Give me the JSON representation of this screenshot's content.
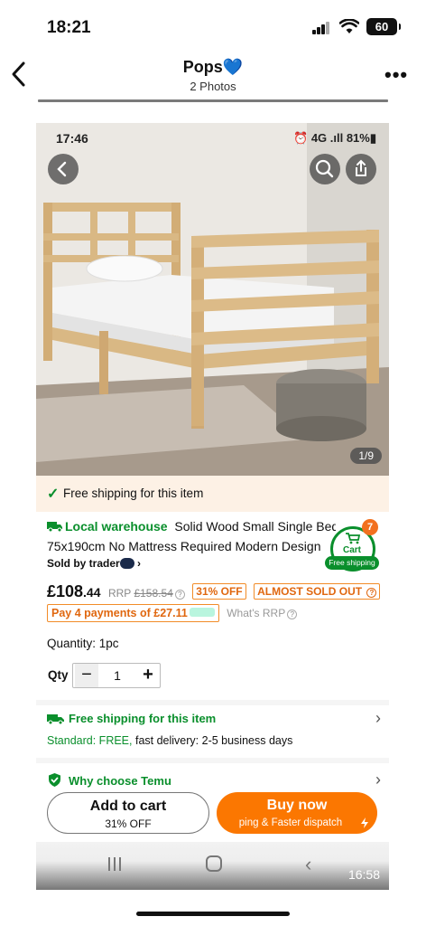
{
  "ios_status": {
    "time": "18:21",
    "battery": "60"
  },
  "header": {
    "title": "Pops💙",
    "subtitle": "2 Photos"
  },
  "photo": {
    "status_time": "17:46",
    "status_right": "⏰ 4G .ıll 81%▮",
    "counter": "1/9"
  },
  "shipping_banner": "Free shipping for this item",
  "product": {
    "local_warehouse": "Local warehouse",
    "title_line1": "Solid Wood Small Single Bed Frame",
    "title_line2": "75x190cm No Mattress Required Modern Design",
    "sold_by": "Sold by trader",
    "price_main": "£108",
    "price_dec": ".44",
    "rrp_label": "RRP",
    "rrp_value": "£158.54",
    "discount": "31% OFF",
    "stock": "ALMOST SOLD OUT",
    "payments": "Pay 4 payments of £27.11",
    "whats_rrp": "What's RRP",
    "quantity_text": "Quantity: 1pc",
    "qty_label": "Qty",
    "qty_value": "1"
  },
  "cart": {
    "badge": "7",
    "label": "Cart",
    "free": "Free shipping"
  },
  "free_shipping": {
    "title": "Free shipping for this item",
    "standard_label": "Standard: FREE,",
    "standard_detail": " fast delivery: 2-5 business days"
  },
  "why": {
    "title": "Why choose Temu"
  },
  "buttons": {
    "add_to_cart": "Add to cart",
    "add_sub": "31% OFF",
    "buy_now": "Buy now",
    "buy_sub": "ping & Faster dispatch"
  },
  "android_nav": {
    "time": "16:58"
  },
  "colors": {
    "green": "#0a8f2c",
    "orange": "#fb7701",
    "badge_orange": "#f2701f"
  }
}
